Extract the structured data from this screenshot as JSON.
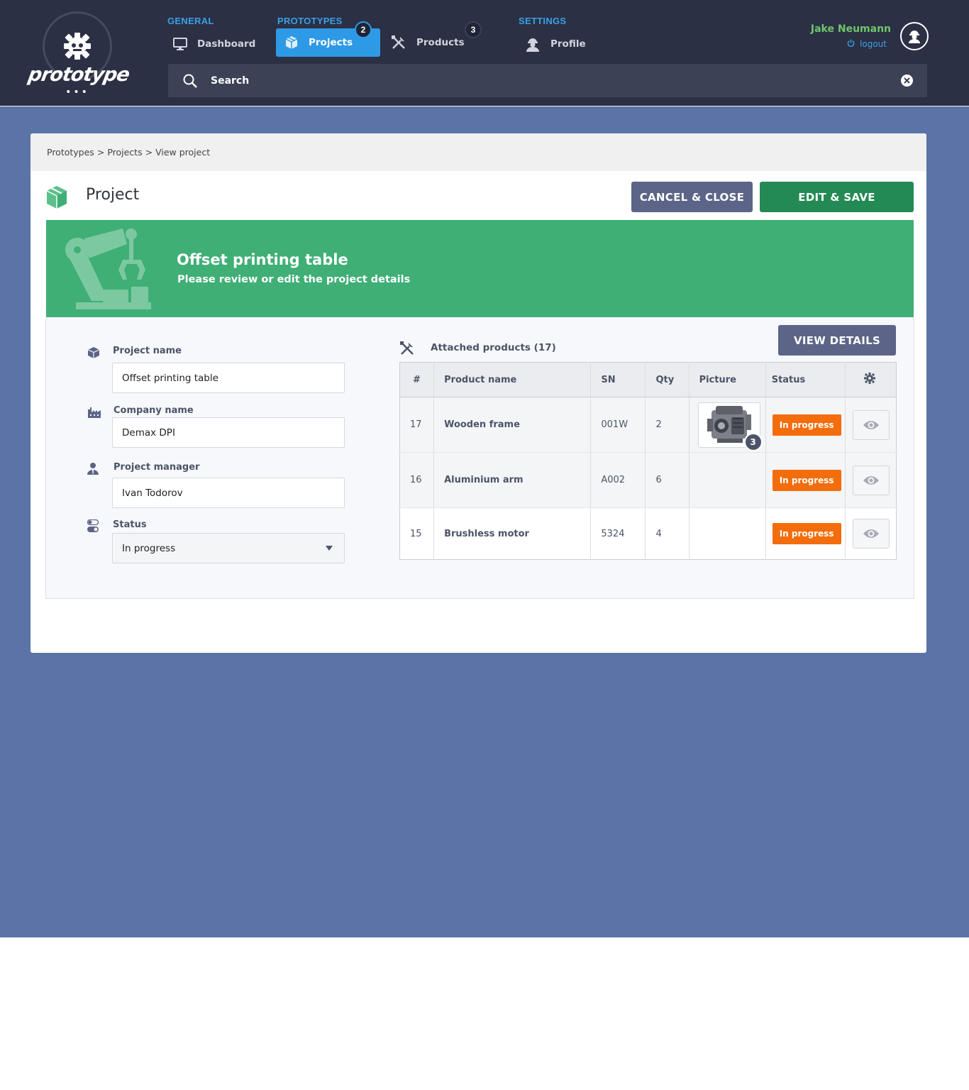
{
  "header": {
    "logo_text": "prototype",
    "nav": {
      "general_label": "GENERAL",
      "prototypes_label": "PROTOTYPES",
      "settings_label": "SETTINGS",
      "dashboard": "Dashboard",
      "projects": "Projects",
      "projects_badge": "2",
      "products": "Products",
      "products_badge": "3",
      "profile": "Profile"
    },
    "user": {
      "name": "Jake Neumann",
      "logout": "logout"
    },
    "search": {
      "placeholder": "Search"
    }
  },
  "breadcrumb": {
    "items": [
      "Prototypes",
      "Projects",
      "View project"
    ],
    "separator": ">"
  },
  "page": {
    "title": "Project",
    "cancel_label": "CANCEL & CLOSE",
    "save_label": "EDIT & SAVE"
  },
  "banner": {
    "title": "Offset printing table",
    "subtitle": "Please review or edit the project details"
  },
  "form": {
    "project_name_label": "Project name",
    "project_name_value": "Offset printing table",
    "company_name_label": "Company name",
    "company_name_value": "Demax DPI",
    "project_manager_label": "Project manager",
    "project_manager_value": "Ivan Todorov",
    "status_label": "Status",
    "status_value": "In progress"
  },
  "products": {
    "label": "Attached products (17)",
    "view_details_label": "VIEW DETAILS",
    "columns": {
      "num": "#",
      "name": "Product name",
      "sn": "SN",
      "qty": "Qty",
      "picture": "Picture",
      "status": "Status"
    },
    "rows": [
      {
        "num": "17",
        "name": "Wooden frame",
        "sn": "001W",
        "qty": "2",
        "picture_count": "3",
        "status": "In progress"
      },
      {
        "num": "16",
        "name": "Aluminium arm",
        "sn": "A002",
        "qty": "6",
        "status": "In progress"
      },
      {
        "num": "15",
        "name": "Brushless motor",
        "sn": "5324",
        "qty": "4",
        "status": "In progress"
      }
    ]
  },
  "colors": {
    "header_bg": "#2b3044",
    "page_bg": "#5b73a6",
    "accent_blue": "#2e9ae6",
    "banner_green": "#3faf76",
    "save_green": "#248a55",
    "status_orange": "#f36d0c",
    "user_green": "#6ec66b"
  },
  "icons": {
    "dashboard": "monitor-icon",
    "projects": "cube-icon",
    "products": "tools-icon",
    "profile": "worker-icon",
    "search": "search-icon",
    "clear": "close-circle-icon",
    "logout": "power-icon",
    "settings": "gear-icon",
    "view": "eye-icon"
  }
}
